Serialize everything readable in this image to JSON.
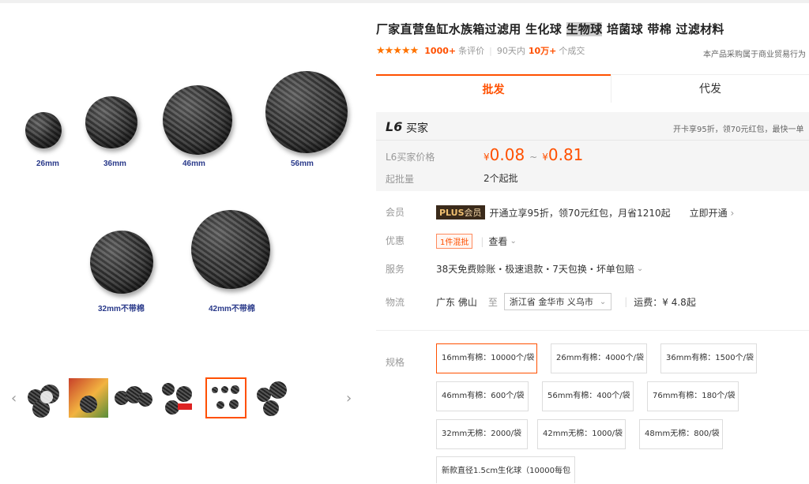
{
  "product": {
    "title_part1": "厂家直营鱼缸水族箱过滤用 生化球 ",
    "title_highlight": "生物球",
    "title_part2": " 培菌球 带棉 过滤材料"
  },
  "rating": {
    "stars": "★★★★★",
    "reviews_count": "1000+",
    "reviews_label": "条评价",
    "period_label": "90天内",
    "sold_count": "10万+",
    "sold_label": "个成交",
    "purchase_note": "本产品采购属于商业贸易行为"
  },
  "tabs": [
    {
      "label": "批发",
      "active": true
    },
    {
      "label": "代发",
      "active": false
    }
  ],
  "buyer_level": {
    "badge": "L6",
    "label": "买家",
    "promo": "开卡享95折，领70元红包，最快一单"
  },
  "price": {
    "label": "L6买家价格",
    "currency": "¥",
    "min": "0.08",
    "max": "0.81",
    "tilde": "~",
    "moq_label": "起批量",
    "moq_value": "2个起批"
  },
  "member": {
    "label": "会员",
    "badge_plus": "PLUS",
    "badge_text": "会员",
    "text": "开通立享95折，领70元红包，月省1210起",
    "link": "立即开通"
  },
  "discount": {
    "label": "优惠",
    "badge": "1件混批",
    "link": "查看"
  },
  "service": {
    "label": "服务",
    "text": "38天免费赊账・极速退款・7天包换・坏单包赔"
  },
  "logistics": {
    "label": "物流",
    "from": "广东 佛山",
    "to_label": "至",
    "to": "浙江省 金华市 义乌市",
    "shipping": "运费：¥ 4.8起"
  },
  "spec": {
    "label": "规格",
    "options": [
      {
        "label": "16mm有棉：10000个/袋",
        "selected": true
      },
      {
        "label": "26mm有棉：4000个/袋",
        "selected": false
      },
      {
        "label": "36mm有棉：1500个/袋",
        "selected": false
      },
      {
        "label": "46mm有棉：600个/袋",
        "selected": false
      },
      {
        "label": "56mm有棉：400个/袋",
        "selected": false
      },
      {
        "label": "76mm有棉：180个/袋",
        "selected": false
      },
      {
        "label": "32mm无棉：2000/袋",
        "selected": false
      },
      {
        "label": "42mm无棉：1000/袋",
        "selected": false
      },
      {
        "label": "48mm无棉：800/袋",
        "selected": false
      },
      {
        "label": "新款直径1.5cm生化球（10000每包",
        "selected": false
      }
    ]
  },
  "gallery": {
    "labels": [
      "26mm",
      "36mm",
      "46mm",
      "56mm",
      "32mm不带棉",
      "42mm不带棉"
    ],
    "prev_arrow": "‹",
    "next_arrow": "›"
  },
  "colors": {
    "accent": "#ff5000",
    "star": "#ff7300"
  }
}
